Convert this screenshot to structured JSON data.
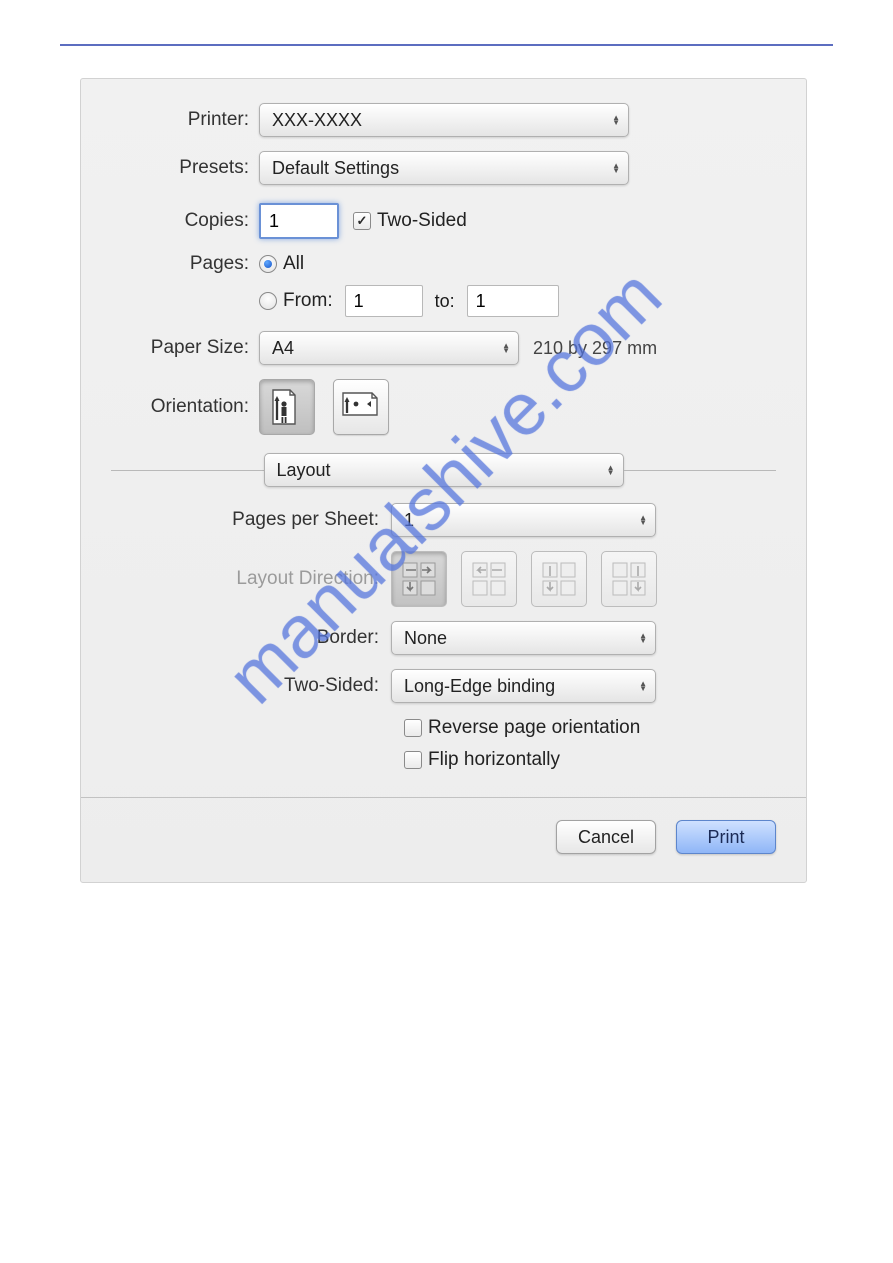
{
  "watermark": "manualshive.com",
  "labels": {
    "printer": "Printer:",
    "presets": "Presets:",
    "copies": "Copies:",
    "two_sided_check": "Two-Sided",
    "pages": "Pages:",
    "all": "All",
    "from": "From:",
    "to": "to:",
    "paper_size": "Paper Size:",
    "orientation": "Orientation:",
    "section": "Layout",
    "pages_per_sheet": "Pages per Sheet:",
    "layout_direction": "Layout Direction:",
    "border": "Border:",
    "two_sided": "Two-Sided:",
    "reverse_page_orientation": "Reverse page orientation",
    "flip_horizontally": "Flip horizontally"
  },
  "values": {
    "printer": "XXX-XXXX",
    "presets": "Default Settings",
    "copies": "1",
    "two_sided_checked": true,
    "pages_all_selected": true,
    "from": "1",
    "to": "1",
    "paper_size": "A4",
    "paper_dimensions": "210 by 297 mm",
    "pages_per_sheet": "1",
    "border": "None",
    "two_sided_mode": "Long-Edge binding",
    "reverse_checked": false,
    "flip_checked": false
  },
  "buttons": {
    "cancel": "Cancel",
    "print": "Print"
  }
}
